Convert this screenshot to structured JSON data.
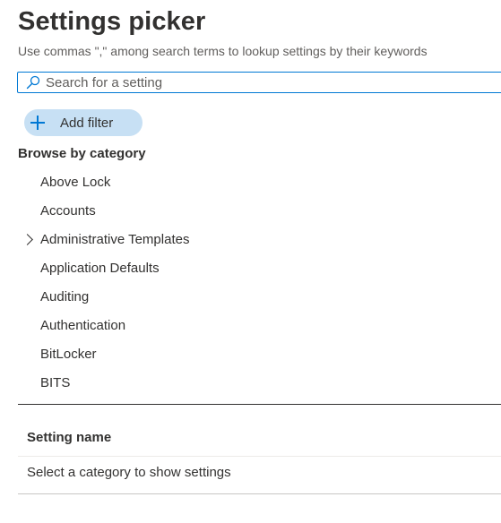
{
  "header": {
    "title": "Settings picker",
    "subtitle": "Use commas \",\" among search terms to lookup settings by their keywords"
  },
  "search": {
    "placeholder": "Search for a setting",
    "value": "",
    "icon": "search-icon"
  },
  "filter": {
    "add_label": "Add filter",
    "icon": "plus-icon"
  },
  "browse": {
    "heading": "Browse by category",
    "categories": [
      {
        "label": "Above Lock",
        "expandable": false
      },
      {
        "label": "Accounts",
        "expandable": false
      },
      {
        "label": "Administrative Templates",
        "expandable": true
      },
      {
        "label": "Application Defaults",
        "expandable": false
      },
      {
        "label": "Auditing",
        "expandable": false
      },
      {
        "label": "Authentication",
        "expandable": false
      },
      {
        "label": "BitLocker",
        "expandable": false
      },
      {
        "label": "BITS",
        "expandable": false
      }
    ]
  },
  "results": {
    "column_header": "Setting name",
    "empty_message": "Select a category to show settings"
  },
  "colors": {
    "accent": "#0078d4",
    "filter_pill": "#c7e0f4",
    "text": "#323130",
    "subtext": "#605e5c"
  }
}
